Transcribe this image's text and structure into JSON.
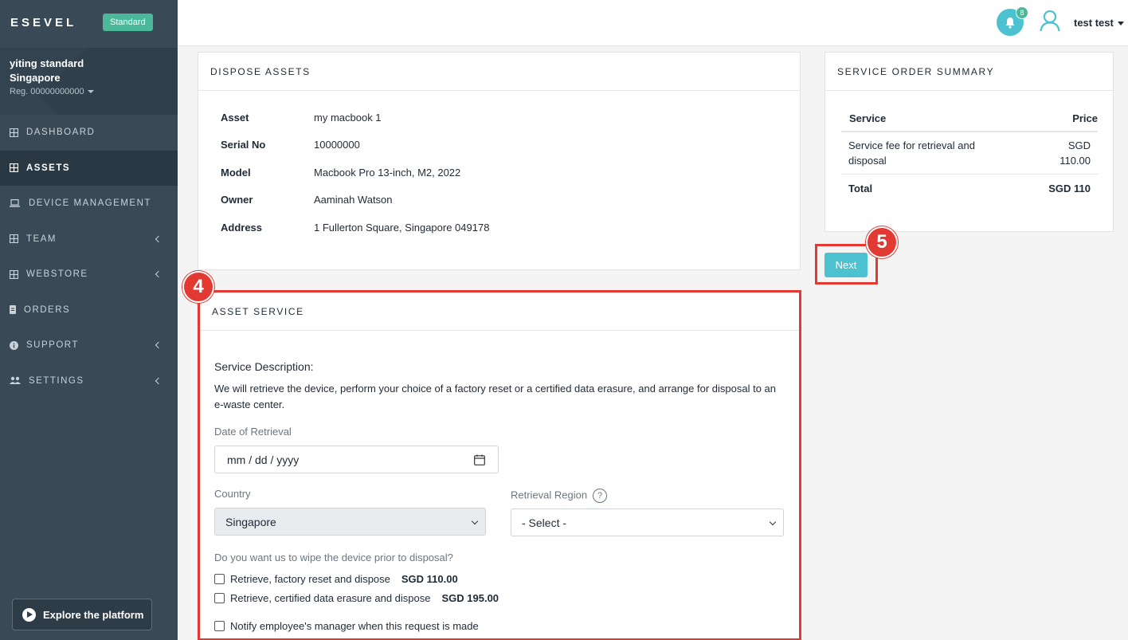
{
  "brand": {
    "name": "ESEVEL",
    "plan_badge": "Standard"
  },
  "account": {
    "name": "yiting standard Singapore",
    "reg": "Reg. 00000000000"
  },
  "nav": [
    {
      "label": "DASHBOARD",
      "icon": "grid-icon",
      "active": false,
      "has_chevron": false
    },
    {
      "label": "ASSETS",
      "icon": "grid-icon",
      "active": true,
      "has_chevron": false
    },
    {
      "label": "DEVICE MANAGEMENT",
      "icon": "laptop-icon",
      "active": false,
      "has_chevron": false
    },
    {
      "label": "TEAM",
      "icon": "grid-icon",
      "active": false,
      "has_chevron": true
    },
    {
      "label": "WEBSTORE",
      "icon": "grid-icon",
      "active": false,
      "has_chevron": true
    },
    {
      "label": "ORDERS",
      "icon": "document-icon",
      "active": false,
      "has_chevron": false
    },
    {
      "label": "SUPPORT",
      "icon": "info-icon",
      "active": false,
      "has_chevron": true
    },
    {
      "label": "SETTINGS",
      "icon": "users-icon",
      "active": false,
      "has_chevron": true
    }
  ],
  "explore_button": "Explore the platform",
  "topbar": {
    "notification_count": "8",
    "user_name": "test test"
  },
  "dispose_assets": {
    "title": "DISPOSE ASSETS",
    "rows": [
      {
        "label": "Asset",
        "value": "my macbook 1"
      },
      {
        "label": "Serial No",
        "value": "10000000"
      },
      {
        "label": "Model",
        "value": "Macbook Pro 13-inch, M2, 2022"
      },
      {
        "label": "Owner",
        "value": "Aaminah Watson"
      },
      {
        "label": "Address",
        "value": "1 Fullerton Square, Singapore 049178"
      }
    ]
  },
  "asset_service": {
    "title": "ASSET SERVICE",
    "desc_title": "Service Description:",
    "desc": "We will retrieve the device, perform your choice of a factory reset or a certified data erasure, and arrange for disposal to an e-waste center.",
    "date_label": "Date of Retrieval",
    "date_placeholder": "mm / dd / yyyy",
    "country_label": "Country",
    "country_value": "Singapore",
    "region_label": "Retrieval Region",
    "region_value": "- Select -",
    "wipe_question": "Do you want us to wipe the device prior to disposal?",
    "options": [
      {
        "label": "Retrieve, factory reset and dispose",
        "price": "SGD 110.00"
      },
      {
        "label": "Retrieve, certified data erasure and dispose",
        "price": "SGD 195.00"
      }
    ],
    "notify_label": "Notify employee's manager when this request is made"
  },
  "summary": {
    "title": "SERVICE ORDER SUMMARY",
    "col_service": "Service",
    "col_price": "Price",
    "item_line1": "Service fee for retrieval and",
    "item_line2": "disposal",
    "item_price_line1": "SGD",
    "item_price_line2": "110.00",
    "total_label": "Total",
    "total_value": "SGD 110"
  },
  "next_button": "Next",
  "annotations": {
    "step4": "4",
    "step5": "5"
  },
  "colors": {
    "sidebar": "#394956",
    "accent": "#4cc1d0",
    "badge": "#4cb89a",
    "annotation": "#e23a33"
  }
}
